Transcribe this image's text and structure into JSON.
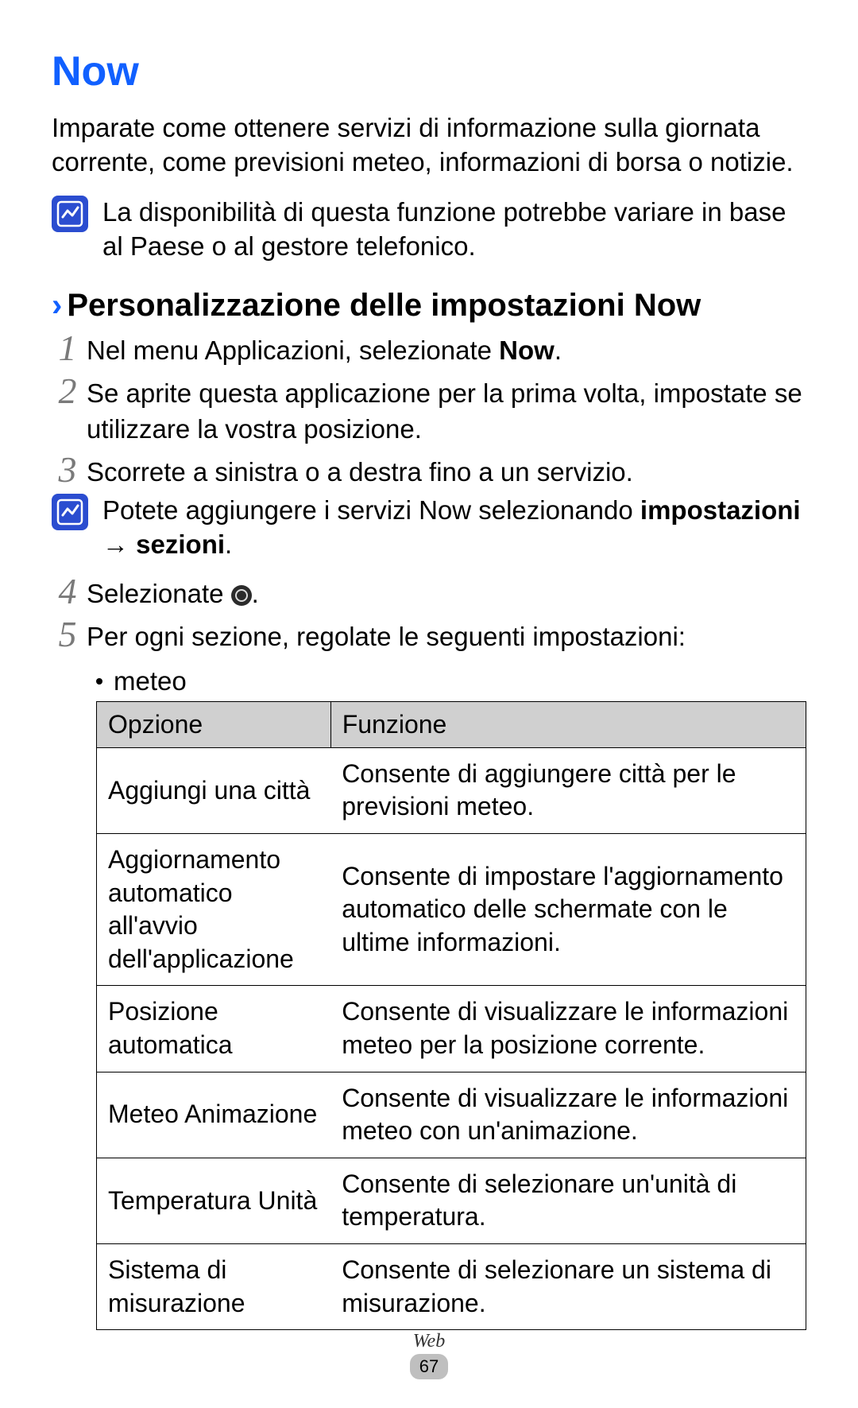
{
  "title": "Now",
  "intro": "Imparate come ottenere servizi di informazione sulla giornata corrente, come previsioni meteo, informazioni di borsa o notizie.",
  "note1": "La disponibilità di questa funzione potrebbe variare in base al Paese o al gestore telefonico.",
  "subheading_caret": "›",
  "subheading": "Personalizzazione delle impostazioni Now",
  "steps": {
    "s1": {
      "num": "1",
      "pre": "Nel menu Applicazioni, selezionate ",
      "bold": "Now",
      "post": "."
    },
    "s2": {
      "num": "2",
      "text": "Se aprite questa applicazione per la prima volta, impostate se utilizzare la vostra posizione."
    },
    "s3": {
      "num": "3",
      "text": "Scorrete a sinistra o a destra fino a un servizio."
    },
    "note2": {
      "pre": "Potete aggiungere i servizi Now selezionando ",
      "bold1": "impostazioni",
      "arrow": " → ",
      "bold2": "sezioni",
      "post": "."
    },
    "s4": {
      "num": "4",
      "pre": "Selezionate ",
      "post": "."
    },
    "s5": {
      "num": "5",
      "text": "Per ogni sezione, regolate le seguenti impostazioni:"
    }
  },
  "bullet": "meteo",
  "table": {
    "headers": {
      "opt": "Opzione",
      "fun": "Funzione"
    },
    "rows": [
      {
        "opt": "Aggiungi una città",
        "fun": "Consente di aggiungere città per le previsioni meteo."
      },
      {
        "opt": "Aggiornamento automatico all'avvio dell'applicazione",
        "fun": "Consente di impostare l'aggiornamento automatico delle schermate con le ultime informazioni."
      },
      {
        "opt": "Posizione automatica",
        "fun": "Consente di visualizzare le informazioni meteo per la posizione corrente."
      },
      {
        "opt": "Meteo Animazione",
        "fun": "Consente di visualizzare le informazioni meteo con un'animazione."
      },
      {
        "opt": "Temperatura Unità",
        "fun": "Consente di selezionare un'unità di temperatura."
      },
      {
        "opt": "Sistema di misurazione",
        "fun": "Consente di selezionare un sistema di misurazione."
      }
    ]
  },
  "footer": {
    "category": "Web",
    "page": "67"
  }
}
